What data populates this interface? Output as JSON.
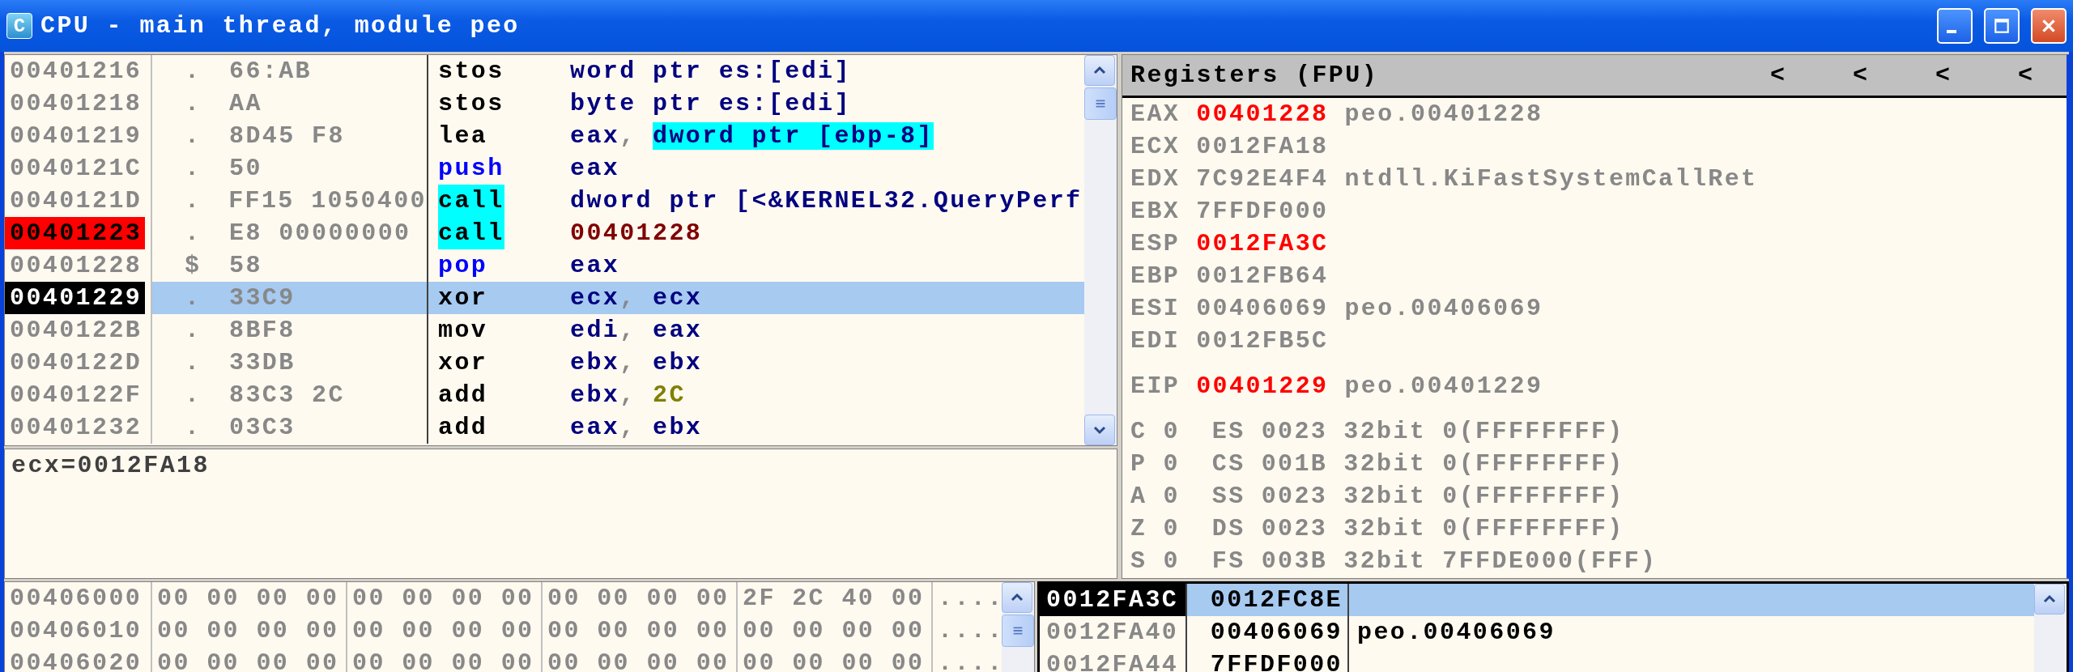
{
  "window": {
    "icon_letter": "C",
    "title": "CPU - main thread, module peo"
  },
  "disassembly": {
    "rows": [
      {
        "address": "00401216",
        "breakpoint": false,
        "current": false,
        "selected": false,
        "marker": ".",
        "bytes": "66:AB",
        "mnemonic": {
          "text": "stos",
          "kind": "plain"
        },
        "operand": [
          {
            "text": "word ptr es:[edi]",
            "kind": "plain"
          }
        ]
      },
      {
        "address": "00401218",
        "breakpoint": false,
        "current": false,
        "selected": false,
        "marker": ".",
        "bytes": "AA",
        "mnemonic": {
          "text": "stos",
          "kind": "plain"
        },
        "operand": [
          {
            "text": "byte ptr es:[edi]",
            "kind": "plain"
          }
        ]
      },
      {
        "address": "00401219",
        "breakpoint": false,
        "current": false,
        "selected": false,
        "marker": ".",
        "bytes": "8D45 F8",
        "mnemonic": {
          "text": "lea",
          "kind": "plain"
        },
        "operand": [
          {
            "text": "eax",
            "kind": "plain"
          },
          {
            "text": ", ",
            "kind": "sep"
          },
          {
            "text": "dword ptr [ebp-8]",
            "kind": "memory"
          }
        ]
      },
      {
        "address": "0040121C",
        "breakpoint": false,
        "current": false,
        "selected": false,
        "marker": ".",
        "bytes": "50",
        "mnemonic": {
          "text": "push",
          "kind": "stack"
        },
        "operand": [
          {
            "text": "eax",
            "kind": "plain"
          }
        ]
      },
      {
        "address": "0040121D",
        "breakpoint": false,
        "current": false,
        "selected": false,
        "marker": ".",
        "bytes": "FF15 1050400",
        "mnemonic": {
          "text": "call",
          "kind": "call"
        },
        "operand": [
          {
            "text": "dword ptr [<&KERNEL32.QueryPerf",
            "kind": "plain"
          }
        ]
      },
      {
        "address": "00401223",
        "breakpoint": true,
        "current": false,
        "selected": false,
        "marker": ".",
        "bytes": "E8 00000000",
        "mnemonic": {
          "text": "call",
          "kind": "call"
        },
        "operand": [
          {
            "text": "00401228",
            "kind": "jump"
          }
        ]
      },
      {
        "address": "00401228",
        "breakpoint": false,
        "current": false,
        "selected": false,
        "marker": "$",
        "bytes": "58",
        "mnemonic": {
          "text": "pop",
          "kind": "stack"
        },
        "operand": [
          {
            "text": "eax",
            "kind": "plain"
          }
        ]
      },
      {
        "address": "00401229",
        "breakpoint": false,
        "current": true,
        "selected": true,
        "marker": ".",
        "bytes": "33C9",
        "mnemonic": {
          "text": "xor",
          "kind": "plain"
        },
        "operand": [
          {
            "text": "ecx",
            "kind": "plain"
          },
          {
            "text": ", ",
            "kind": "sep"
          },
          {
            "text": "ecx",
            "kind": "plain"
          }
        ]
      },
      {
        "address": "0040122B",
        "breakpoint": false,
        "current": false,
        "selected": false,
        "marker": ".",
        "bytes": "8BF8",
        "mnemonic": {
          "text": "mov",
          "kind": "plain"
        },
        "operand": [
          {
            "text": "edi",
            "kind": "plain"
          },
          {
            "text": ", ",
            "kind": "sep"
          },
          {
            "text": "eax",
            "kind": "plain"
          }
        ]
      },
      {
        "address": "0040122D",
        "breakpoint": false,
        "current": false,
        "selected": false,
        "marker": ".",
        "bytes": "33DB",
        "mnemonic": {
          "text": "xor",
          "kind": "plain"
        },
        "operand": [
          {
            "text": "ebx",
            "kind": "plain"
          },
          {
            "text": ", ",
            "kind": "sep"
          },
          {
            "text": "ebx",
            "kind": "plain"
          }
        ]
      },
      {
        "address": "0040122F",
        "breakpoint": false,
        "current": false,
        "selected": false,
        "marker": ".",
        "bytes": "83C3 2C",
        "mnemonic": {
          "text": "add",
          "kind": "plain"
        },
        "operand": [
          {
            "text": "ebx",
            "kind": "plain"
          },
          {
            "text": ", ",
            "kind": "sep"
          },
          {
            "text": "2C",
            "kind": "const"
          }
        ]
      },
      {
        "address": "00401232",
        "breakpoint": false,
        "current": false,
        "selected": false,
        "marker": ".",
        "bytes": "03C3",
        "mnemonic": {
          "text": "add",
          "kind": "plain"
        },
        "operand": [
          {
            "text": "eax",
            "kind": "plain"
          },
          {
            "text": ", ",
            "kind": "sep"
          },
          {
            "text": "ebx",
            "kind": "plain"
          }
        ]
      }
    ]
  },
  "info": {
    "text": "ecx=0012FA18"
  },
  "registers": {
    "title": "Registers (FPU)",
    "header_buttons": [
      "<",
      "<",
      "<",
      "<"
    ],
    "general": [
      {
        "name": "EAX",
        "value": "00401228",
        "changed": true,
        "comment": "peo.00401228"
      },
      {
        "name": "ECX",
        "value": "0012FA18",
        "changed": false
      },
      {
        "name": "EDX",
        "value": "7C92E4F4",
        "changed": false,
        "comment": "ntdll.KiFastSystemCallRet"
      },
      {
        "name": "EBX",
        "value": "7FFDF000",
        "changed": false
      },
      {
        "name": "ESP",
        "value": "0012FA3C",
        "changed": true
      },
      {
        "name": "EBP",
        "value": "0012FB64",
        "changed": false
      },
      {
        "name": "ESI",
        "value": "00406069",
        "changed": false,
        "comment": "peo.00406069"
      },
      {
        "name": "EDI",
        "value": "0012FB5C",
        "changed": false
      }
    ],
    "eip": {
      "name": "EIP",
      "value": "00401229",
      "changed": true,
      "comment": "peo.00401229"
    },
    "flags": [
      {
        "flag": "C",
        "value": "0",
        "segment": "ES",
        "selector": "0023",
        "bits": "32bit",
        "base": "0(FFFFFFFF)"
      },
      {
        "flag": "P",
        "value": "0",
        "segment": "CS",
        "selector": "001B",
        "bits": "32bit",
        "base": "0(FFFFFFFF)"
      },
      {
        "flag": "A",
        "value": "0",
        "segment": "SS",
        "selector": "0023",
        "bits": "32bit",
        "base": "0(FFFFFFFF)"
      },
      {
        "flag": "Z",
        "value": "0",
        "segment": "DS",
        "selector": "0023",
        "bits": "32bit",
        "base": "0(FFFFFFFF)"
      },
      {
        "flag": "S",
        "value": "0",
        "segment": "FS",
        "selector": "003B",
        "bits": "32bit",
        "base": "7FFDE000(FFF)"
      }
    ]
  },
  "dump": {
    "rows": [
      {
        "address": "00406000",
        "groups": [
          "00 00 00 00",
          "00 00 00 00",
          "00 00 00 00",
          "2F 2C 40 00"
        ],
        "ascii": "...."
      },
      {
        "address": "00406010",
        "groups": [
          "00 00 00 00",
          "00 00 00 00",
          "00 00 00 00",
          "00 00 00 00"
        ],
        "ascii": "...."
      },
      {
        "address": "00406020",
        "groups": [
          "00 00 00 00",
          "00 00 00 00",
          "00 00 00 00",
          "00 00 00 00"
        ],
        "ascii": "...."
      }
    ]
  },
  "stack": {
    "rows": [
      {
        "address": "0012FA3C",
        "top": true,
        "selected": true,
        "value": "0012FC8E"
      },
      {
        "address": "0012FA40",
        "top": false,
        "selected": false,
        "value": "00406069",
        "comment": "peo.00406069"
      },
      {
        "address": "0012FA44",
        "top": false,
        "selected": false,
        "value": "7FFDF000"
      }
    ]
  }
}
